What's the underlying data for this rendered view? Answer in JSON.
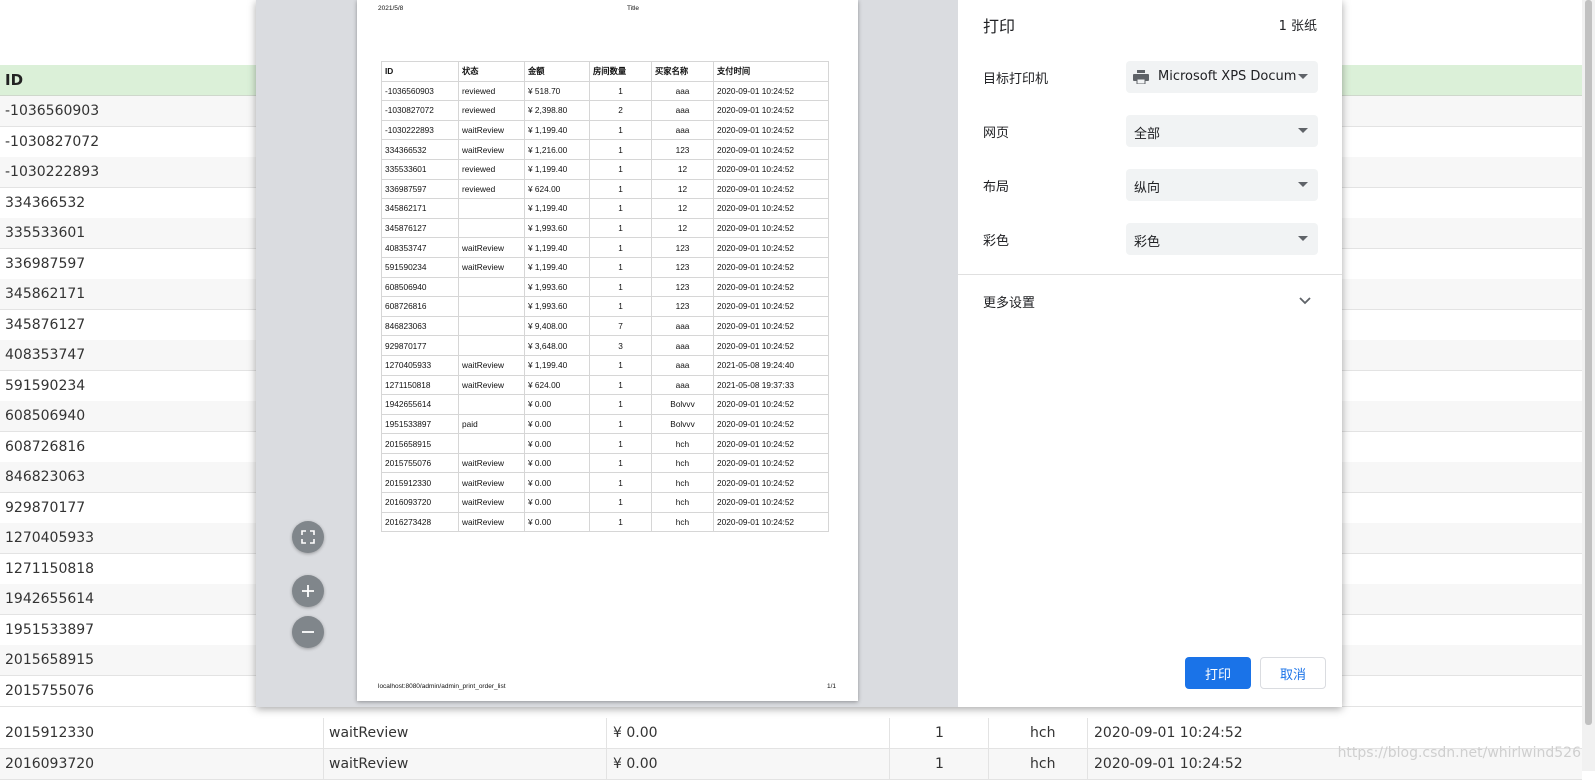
{
  "background": {
    "header_id": "ID",
    "rows": [
      {
        "id": "-1036560903"
      },
      {
        "id": "-1030827072"
      },
      {
        "id": "-1030222893"
      },
      {
        "id": "334366532"
      },
      {
        "id": "335533601"
      },
      {
        "id": "336987597"
      },
      {
        "id": "345862171"
      },
      {
        "id": "345876127"
      },
      {
        "id": "408353747"
      },
      {
        "id": "591590234"
      },
      {
        "id": "608506940"
      },
      {
        "id": "608726816"
      },
      {
        "id": "846823063"
      },
      {
        "id": "929870177"
      },
      {
        "id": "1270405933"
      },
      {
        "id": "1271150818"
      },
      {
        "id": "1942655614"
      },
      {
        "id": "1951533897"
      },
      {
        "id": "2015658915"
      },
      {
        "id": "2015755076"
      }
    ],
    "full_rows": [
      {
        "id": "2015912330",
        "status": "waitReview",
        "amount": "¥ 0.00",
        "rooms": "1",
        "buyer": "hch",
        "time": "2020-09-01 10:24:52"
      },
      {
        "id": "2016093720",
        "status": "waitReview",
        "amount": "¥ 0.00",
        "rooms": "1",
        "buyer": "hch",
        "time": "2020-09-01 10:24:52"
      }
    ]
  },
  "preview": {
    "date": "2021/5/8",
    "title": "Title",
    "url": "localhost:8080/admin/admin_print_order_list",
    "page": "1/1",
    "columns": [
      "ID",
      "状态",
      "金额",
      "房间数量",
      "买家名称",
      "支付时间"
    ],
    "rows": [
      [
        "-1036560903",
        "reviewed",
        "¥ 518.70",
        "1",
        "aaa",
        "2020-09-01 10:24:52"
      ],
      [
        "-1030827072",
        "reviewed",
        "¥ 2,398.80",
        "2",
        "aaa",
        "2020-09-01 10:24:52"
      ],
      [
        "-1030222893",
        "waitReview",
        "¥ 1,199.40",
        "1",
        "aaa",
        "2020-09-01 10:24:52"
      ],
      [
        "334366532",
        "waitReview",
        "¥ 1,216.00",
        "1",
        "123",
        "2020-09-01 10:24:52"
      ],
      [
        "335533601",
        "reviewed",
        "¥ 1,199.40",
        "1",
        "12",
        "2020-09-01 10:24:52"
      ],
      [
        "336987597",
        "reviewed",
        "¥ 624.00",
        "1",
        "12",
        "2020-09-01 10:24:52"
      ],
      [
        "345862171",
        "",
        "¥ 1,199.40",
        "1",
        "12",
        "2020-09-01 10:24:52"
      ],
      [
        "345876127",
        "",
        "¥ 1,993.60",
        "1",
        "12",
        "2020-09-01 10:24:52"
      ],
      [
        "408353747",
        "waitReview",
        "¥ 1,199.40",
        "1",
        "123",
        "2020-09-01 10:24:52"
      ],
      [
        "591590234",
        "waitReview",
        "¥ 1,199.40",
        "1",
        "123",
        "2020-09-01 10:24:52"
      ],
      [
        "608506940",
        "",
        "¥ 1,993.60",
        "1",
        "123",
        "2020-09-01 10:24:52"
      ],
      [
        "608726816",
        "",
        "¥ 1,993.60",
        "1",
        "123",
        "2020-09-01 10:24:52"
      ],
      [
        "846823063",
        "",
        "¥ 9,408.00",
        "7",
        "aaa",
        "2020-09-01 10:24:52"
      ],
      [
        "929870177",
        "",
        "¥ 3,648.00",
        "3",
        "aaa",
        "2020-09-01 10:24:52"
      ],
      [
        "1270405933",
        "waitReview",
        "¥ 1,199.40",
        "1",
        "aaa",
        "2021-05-08 19:24:40"
      ],
      [
        "1271150818",
        "waitReview",
        "¥ 624.00",
        "1",
        "aaa",
        "2021-05-08 19:37:33"
      ],
      [
        "1942655614",
        "",
        "¥ 0.00",
        "1",
        "Bolvvv",
        "2020-09-01 10:24:52"
      ],
      [
        "1951533897",
        "paid",
        "¥ 0.00",
        "1",
        "Bolvvv",
        "2020-09-01 10:24:52"
      ],
      [
        "2015658915",
        "",
        "¥ 0.00",
        "1",
        "hch",
        "2020-09-01 10:24:52"
      ],
      [
        "2015755076",
        "waitReview",
        "¥ 0.00",
        "1",
        "hch",
        "2020-09-01 10:24:52"
      ],
      [
        "2015912330",
        "waitReview",
        "¥ 0.00",
        "1",
        "hch",
        "2020-09-01 10:24:52"
      ],
      [
        "2016093720",
        "waitReview",
        "¥ 0.00",
        "1",
        "hch",
        "2020-09-01 10:24:52"
      ],
      [
        "2016273428",
        "waitReview",
        "¥ 0.00",
        "1",
        "hch",
        "2020-09-01 10:24:52"
      ]
    ]
  },
  "settings": {
    "title": "打印",
    "sheets": "1 张纸",
    "destination_label": "目标打印机",
    "destination_value": "Microsoft XPS Docum",
    "pages_label": "网页",
    "pages_value": "全部",
    "layout_label": "布局",
    "layout_value": "纵向",
    "color_label": "彩色",
    "color_value": "彩色",
    "more_settings": "更多设置",
    "print_button": "打印",
    "cancel_button": "取消"
  },
  "colors": {
    "accent": "#1a73e8",
    "header_bg": "#dbf0d8"
  },
  "icons": {
    "fit": "fit-to-page-icon",
    "zoom_in": "zoom-in-icon",
    "zoom_out": "zoom-out-icon",
    "printer": "printer-icon",
    "chevron": "chevron-down-icon"
  },
  "watermark": "https://blog.csdn.net/whirlwind526"
}
